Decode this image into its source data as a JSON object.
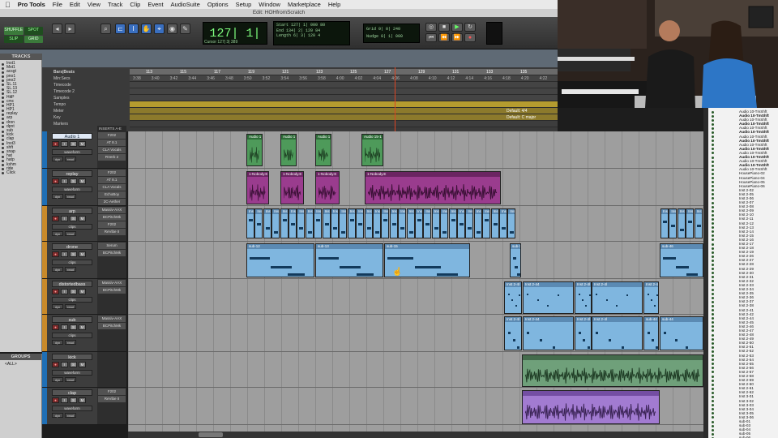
{
  "menubar": {
    "apple": "",
    "app": "Pro Tools",
    "items": [
      "File",
      "Edit",
      "View",
      "Track",
      "Clip",
      "Event",
      "AudioSuite",
      "Options",
      "Setup",
      "Window",
      "Marketplace",
      "Help"
    ]
  },
  "window_title": "Edit: HOHfromScratch",
  "toolbar": {
    "modes": [
      "SHUFFLE",
      "SPOT",
      "SLIP",
      "GRID"
    ],
    "main_counter": "127| 1| 000",
    "cursor_label": "Cursor",
    "cursor_value": "127| 3| 389",
    "selection": {
      "start_label": "Start",
      "start": "127| 1| 000",
      "end_label": "End",
      "end": "134| 2| 120",
      "length_label": "Length",
      "length": "6| 3| 120",
      "right": [
        "80",
        "84",
        "4"
      ]
    },
    "grid_label": "Grid",
    "grid_value": "0| 0| 240",
    "nudge_label": "Nudge",
    "nudge_value": "0| 1| 000"
  },
  "rulers": {
    "bars_label": "Bars|Beats",
    "rows": [
      "Min:Secs",
      "Timecode",
      "Timecode 2",
      "Samples",
      "Tempo",
      "Meter",
      "Key",
      "Markers"
    ],
    "bar_numbers": [
      "113",
      "115",
      "117",
      "119",
      "121",
      "123",
      "125",
      "127",
      "129",
      "131",
      "133",
      "135"
    ],
    "min_secs": [
      "3:38",
      "3:40",
      "3:42",
      "3:44",
      "3:46",
      "3:48",
      "3:50",
      "3:52",
      "3:54",
      "3:56",
      "3:58",
      "4:00",
      "4:02",
      "4:04",
      "4:06",
      "4:08",
      "4:10",
      "4:12",
      "4:14",
      "4:16",
      "4:18",
      "4:20",
      "4:22"
    ],
    "meter_text": "Default: 4/4",
    "key_text": "Default: C major"
  },
  "tracks_header": "TRACKS",
  "track_list": [
    "Inst1",
    "Mst1",
    "acsgt",
    "pno1",
    "pno2",
    "SL.11",
    "SL.13",
    "SL.12",
    "HitP",
    "cmc",
    "HP1",
    "HP1",
    "replay",
    "arp",
    "dron",
    "dpnt",
    "sub",
    "kick",
    "clap",
    "Inst3",
    "shft",
    "snap",
    "hat",
    "hatp",
    "kshm",
    "ride",
    "Click"
  ],
  "groups": {
    "header": "GROUPS",
    "all": "<ALL>"
  },
  "inserts_header": "INSERTS A-E",
  "tracks": [
    {
      "name": "Audio 1",
      "mode": "waveform",
      "inserts": [
        "F202",
        "AT 8.1",
        "CLA Vocals",
        "RVerb 2"
      ],
      "color": "#1f6fb5"
    },
    {
      "name": "replay",
      "mode": "waveform",
      "inserts": [
        "F202",
        "AT 8.1",
        "CLA Vocals",
        "EchoBoy",
        "2C-Aether"
      ],
      "color": "#1f6fb5"
    },
    {
      "name": "arp",
      "mode": "clips",
      "inserts": [
        "Massiv-AAX",
        "BCPitchMk",
        "F202",
        "ReVibe II"
      ],
      "color": "#c98a2a"
    },
    {
      "name": "drone",
      "mode": "clips",
      "inserts": [
        "Serum",
        "BCPitchMk"
      ],
      "color": "#c98a2a"
    },
    {
      "name": "distortedbass",
      "mode": "clips",
      "inserts": [
        "Massiv-AAX",
        "BCPitchMk"
      ],
      "color": "#c98a2a"
    },
    {
      "name": "sub",
      "mode": "clips",
      "inserts": [
        "Massiv-AAX",
        "BCPitchMk"
      ],
      "color": "#c98a2a"
    },
    {
      "name": "kick",
      "mode": "waveform",
      "inserts": [],
      "color": "#1f6fb5"
    },
    {
      "name": "clap",
      "mode": "waveform",
      "inserts": [
        "F202",
        "ReVibe II"
      ],
      "color": "#1f6fb5"
    }
  ],
  "track_buttons": {
    "rec": "●",
    "input": "I",
    "solo": "S",
    "mute": "M",
    "dyn": "dyn",
    "read": "read",
    "none": "none"
  },
  "clips": {
    "audio1": [
      "Audio 1",
      "Audio 1",
      "Audio 1",
      "Audio 15-1"
    ],
    "replay": [
      "1-Nobody.E",
      "1-Nobody.E",
      "1-Nobody.E",
      "1-Nobody.E"
    ],
    "arp": "Inst",
    "drone": [
      "sub-12",
      "sub-13",
      "sub-15",
      "sub-16",
      "sub-46"
    ],
    "distorted": [
      "Inst 2-4l",
      "Inst 2-44",
      "Inst 2-4l",
      "Inst 2-4l"
    ],
    "sub": [
      "Inst 2-4l",
      "Inst 2-44",
      "Inst 2-4l",
      "Inst 2-4l",
      "sub-44"
    ]
  },
  "clip_list": [
    {
      "t": "Audio 10-TmShft",
      "b": false
    },
    {
      "t": "Audio 10-TmShft",
      "b": true
    },
    {
      "t": "Audio 10-TmShft",
      "b": false
    },
    {
      "t": "Audio 10-TmShft",
      "b": true
    },
    {
      "t": "Audio 10-TmShft",
      "b": false
    },
    {
      "t": "Audio 10-TmShft",
      "b": true
    },
    {
      "t": "Audio 10-TmShft",
      "b": false
    },
    {
      "t": "Audio 10-TmShft",
      "b": true
    },
    {
      "t": "Audio 10-TmShft",
      "b": false
    },
    {
      "t": "Audio 10-TmShft",
      "b": true
    },
    {
      "t": "Audio 10-TmShft",
      "b": false
    },
    {
      "t": "Audio 10-TmShft",
      "b": true
    },
    {
      "t": "Audio 10-TmShft",
      "b": false
    },
    {
      "t": "Audio 10-TmShft",
      "b": true
    },
    {
      "t": "Audio 10-TmShft",
      "b": false
    },
    {
      "t": "HousePiano-02",
      "b": false
    },
    {
      "t": "HousePiano-04",
      "b": false
    },
    {
      "t": "HousePiano-05",
      "b": false
    },
    {
      "t": "HousePiano-06",
      "b": false
    },
    {
      "t": "Inst 2-02",
      "b": false
    },
    {
      "t": "Inst 2-05",
      "b": false
    },
    {
      "t": "Inst 2-06",
      "b": false
    },
    {
      "t": "Inst 2-07",
      "b": false
    },
    {
      "t": "Inst 2-08",
      "b": false
    },
    {
      "t": "Inst 2-09",
      "b": false
    },
    {
      "t": "Inst 2-10",
      "b": false
    },
    {
      "t": "Inst 2-11",
      "b": false
    },
    {
      "t": "Inst 2-12",
      "b": false
    },
    {
      "t": "Inst 2-13",
      "b": false
    },
    {
      "t": "Inst 2-14",
      "b": false
    },
    {
      "t": "Inst 2-15",
      "b": false
    },
    {
      "t": "Inst 2-16",
      "b": false
    },
    {
      "t": "Inst 2-17",
      "b": false
    },
    {
      "t": "Inst 2-18",
      "b": false
    },
    {
      "t": "Inst 2-19",
      "b": false
    },
    {
      "t": "Inst 2-26",
      "b": false
    },
    {
      "t": "Inst 2-27",
      "b": false
    },
    {
      "t": "Inst 2-28",
      "b": false
    },
    {
      "t": "Inst 2-29",
      "b": false
    },
    {
      "t": "Inst 2-30",
      "b": false
    },
    {
      "t": "Inst 2-31",
      "b": false
    },
    {
      "t": "Inst 2-32",
      "b": false
    },
    {
      "t": "Inst 2-33",
      "b": false
    },
    {
      "t": "Inst 2-34",
      "b": false
    },
    {
      "t": "Inst 2-35",
      "b": false
    },
    {
      "t": "Inst 2-36",
      "b": false
    },
    {
      "t": "Inst 2-37",
      "b": false
    },
    {
      "t": "Inst 2-38",
      "b": false
    },
    {
      "t": "Inst 2-41",
      "b": false
    },
    {
      "t": "Inst 2-42",
      "b": false
    },
    {
      "t": "Inst 2-44",
      "b": false
    },
    {
      "t": "Inst 2-45",
      "b": false
    },
    {
      "t": "Inst 2-46",
      "b": false
    },
    {
      "t": "Inst 2-47",
      "b": false
    },
    {
      "t": "Inst 2-48",
      "b": false
    },
    {
      "t": "Inst 2-49",
      "b": false
    },
    {
      "t": "Inst 2-50",
      "b": false
    },
    {
      "t": "Inst 2-51",
      "b": false
    },
    {
      "t": "Inst 2-52",
      "b": false
    },
    {
      "t": "Inst 2-53",
      "b": false
    },
    {
      "t": "Inst 2-54",
      "b": false
    },
    {
      "t": "Inst 2-55",
      "b": false
    },
    {
      "t": "Inst 2-56",
      "b": false
    },
    {
      "t": "Inst 2-57",
      "b": false
    },
    {
      "t": "Inst 2-58",
      "b": false
    },
    {
      "t": "Inst 2-59",
      "b": false
    },
    {
      "t": "Inst 2-60",
      "b": false
    },
    {
      "t": "Inst 2-61",
      "b": false
    },
    {
      "t": "Inst 2-62",
      "b": false
    },
    {
      "t": "Inst 3-01",
      "b": false
    },
    {
      "t": "Inst 3-02",
      "b": false
    },
    {
      "t": "Inst 3-03",
      "b": false
    },
    {
      "t": "Inst 3-04",
      "b": false
    },
    {
      "t": "Inst 3-05",
      "b": false
    },
    {
      "t": "Inst 3-06",
      "b": false
    },
    {
      "t": "sub-01",
      "b": false
    },
    {
      "t": "sub-03",
      "b": false
    },
    {
      "t": "sub-04",
      "b": false
    },
    {
      "t": "sub-05",
      "b": false
    },
    {
      "t": "sub-06",
      "b": false
    },
    {
      "t": "sub-07",
      "b": false
    },
    {
      "t": "sub-08",
      "b": false
    },
    {
      "t": "sub-09",
      "b": false
    },
    {
      "t": "sub-10",
      "b": false
    }
  ]
}
